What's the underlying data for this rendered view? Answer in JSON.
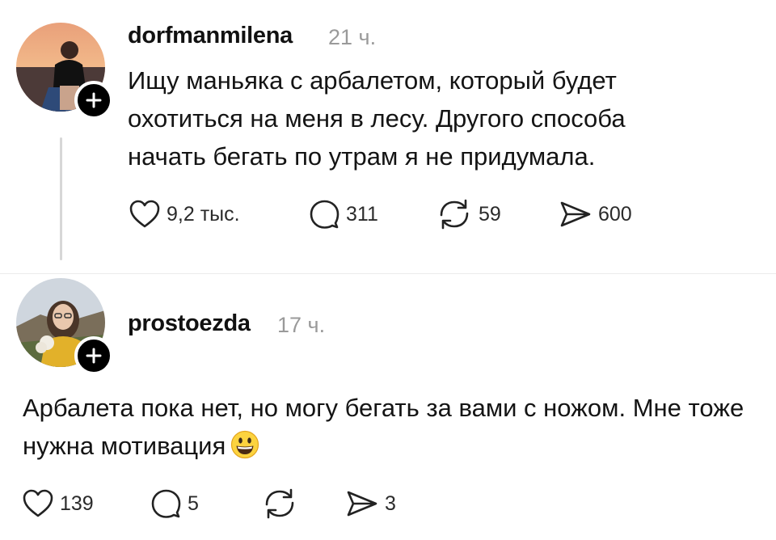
{
  "post1": {
    "username": "dorfmanmilena",
    "time": "21 ч.",
    "text": "Ищу маньяка с арбалетом, который будет охотиться на меня в лесу. Другого способа начать бегать по утрам я не придумала.",
    "likes": "9,2 тыс.",
    "replies": "311",
    "reposts": "59",
    "shares": "600"
  },
  "post2": {
    "username": "prostoezda",
    "time": "17 ч.",
    "text": "Арбалета пока нет, но могу бегать за вами с ножом. Мне тоже нужна мотивация",
    "emoji": "grinning-face",
    "likes": "139",
    "replies": "5",
    "reposts": "",
    "shares": "3"
  },
  "icons": {
    "like": "heart-icon",
    "reply": "speech-bubble-icon",
    "repost": "repost-arrows-icon",
    "share": "paper-plane-icon",
    "follow": "plus-icon"
  }
}
